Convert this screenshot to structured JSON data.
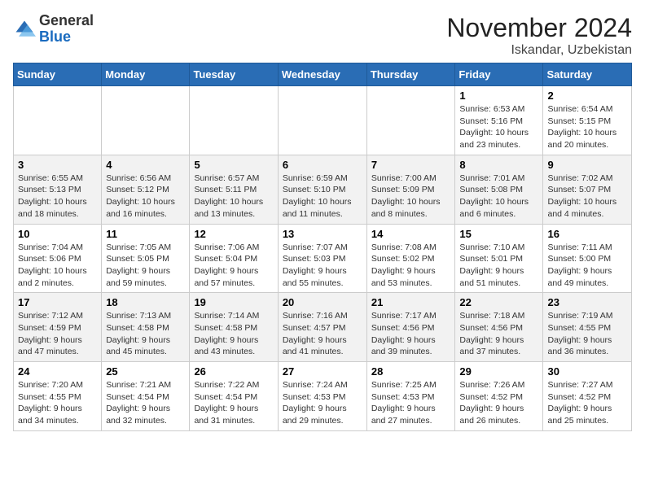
{
  "header": {
    "logo_general": "General",
    "logo_blue": "Blue",
    "month_title": "November 2024",
    "location": "Iskandar, Uzbekistan"
  },
  "columns": [
    "Sunday",
    "Monday",
    "Tuesday",
    "Wednesday",
    "Thursday",
    "Friday",
    "Saturday"
  ],
  "weeks": [
    [
      {
        "day": "",
        "info": ""
      },
      {
        "day": "",
        "info": ""
      },
      {
        "day": "",
        "info": ""
      },
      {
        "day": "",
        "info": ""
      },
      {
        "day": "",
        "info": ""
      },
      {
        "day": "1",
        "info": "Sunrise: 6:53 AM\nSunset: 5:16 PM\nDaylight: 10 hours\nand 23 minutes."
      },
      {
        "day": "2",
        "info": "Sunrise: 6:54 AM\nSunset: 5:15 PM\nDaylight: 10 hours\nand 20 minutes."
      }
    ],
    [
      {
        "day": "3",
        "info": "Sunrise: 6:55 AM\nSunset: 5:13 PM\nDaylight: 10 hours\nand 18 minutes."
      },
      {
        "day": "4",
        "info": "Sunrise: 6:56 AM\nSunset: 5:12 PM\nDaylight: 10 hours\nand 16 minutes."
      },
      {
        "day": "5",
        "info": "Sunrise: 6:57 AM\nSunset: 5:11 PM\nDaylight: 10 hours\nand 13 minutes."
      },
      {
        "day": "6",
        "info": "Sunrise: 6:59 AM\nSunset: 5:10 PM\nDaylight: 10 hours\nand 11 minutes."
      },
      {
        "day": "7",
        "info": "Sunrise: 7:00 AM\nSunset: 5:09 PM\nDaylight: 10 hours\nand 8 minutes."
      },
      {
        "day": "8",
        "info": "Sunrise: 7:01 AM\nSunset: 5:08 PM\nDaylight: 10 hours\nand 6 minutes."
      },
      {
        "day": "9",
        "info": "Sunrise: 7:02 AM\nSunset: 5:07 PM\nDaylight: 10 hours\nand 4 minutes."
      }
    ],
    [
      {
        "day": "10",
        "info": "Sunrise: 7:04 AM\nSunset: 5:06 PM\nDaylight: 10 hours\nand 2 minutes."
      },
      {
        "day": "11",
        "info": "Sunrise: 7:05 AM\nSunset: 5:05 PM\nDaylight: 9 hours\nand 59 minutes."
      },
      {
        "day": "12",
        "info": "Sunrise: 7:06 AM\nSunset: 5:04 PM\nDaylight: 9 hours\nand 57 minutes."
      },
      {
        "day": "13",
        "info": "Sunrise: 7:07 AM\nSunset: 5:03 PM\nDaylight: 9 hours\nand 55 minutes."
      },
      {
        "day": "14",
        "info": "Sunrise: 7:08 AM\nSunset: 5:02 PM\nDaylight: 9 hours\nand 53 minutes."
      },
      {
        "day": "15",
        "info": "Sunrise: 7:10 AM\nSunset: 5:01 PM\nDaylight: 9 hours\nand 51 minutes."
      },
      {
        "day": "16",
        "info": "Sunrise: 7:11 AM\nSunset: 5:00 PM\nDaylight: 9 hours\nand 49 minutes."
      }
    ],
    [
      {
        "day": "17",
        "info": "Sunrise: 7:12 AM\nSunset: 4:59 PM\nDaylight: 9 hours\nand 47 minutes."
      },
      {
        "day": "18",
        "info": "Sunrise: 7:13 AM\nSunset: 4:58 PM\nDaylight: 9 hours\nand 45 minutes."
      },
      {
        "day": "19",
        "info": "Sunrise: 7:14 AM\nSunset: 4:58 PM\nDaylight: 9 hours\nand 43 minutes."
      },
      {
        "day": "20",
        "info": "Sunrise: 7:16 AM\nSunset: 4:57 PM\nDaylight: 9 hours\nand 41 minutes."
      },
      {
        "day": "21",
        "info": "Sunrise: 7:17 AM\nSunset: 4:56 PM\nDaylight: 9 hours\nand 39 minutes."
      },
      {
        "day": "22",
        "info": "Sunrise: 7:18 AM\nSunset: 4:56 PM\nDaylight: 9 hours\nand 37 minutes."
      },
      {
        "day": "23",
        "info": "Sunrise: 7:19 AM\nSunset: 4:55 PM\nDaylight: 9 hours\nand 36 minutes."
      }
    ],
    [
      {
        "day": "24",
        "info": "Sunrise: 7:20 AM\nSunset: 4:55 PM\nDaylight: 9 hours\nand 34 minutes."
      },
      {
        "day": "25",
        "info": "Sunrise: 7:21 AM\nSunset: 4:54 PM\nDaylight: 9 hours\nand 32 minutes."
      },
      {
        "day": "26",
        "info": "Sunrise: 7:22 AM\nSunset: 4:54 PM\nDaylight: 9 hours\nand 31 minutes."
      },
      {
        "day": "27",
        "info": "Sunrise: 7:24 AM\nSunset: 4:53 PM\nDaylight: 9 hours\nand 29 minutes."
      },
      {
        "day": "28",
        "info": "Sunrise: 7:25 AM\nSunset: 4:53 PM\nDaylight: 9 hours\nand 27 minutes."
      },
      {
        "day": "29",
        "info": "Sunrise: 7:26 AM\nSunset: 4:52 PM\nDaylight: 9 hours\nand 26 minutes."
      },
      {
        "day": "30",
        "info": "Sunrise: 7:27 AM\nSunset: 4:52 PM\nDaylight: 9 hours\nand 25 minutes."
      }
    ]
  ]
}
